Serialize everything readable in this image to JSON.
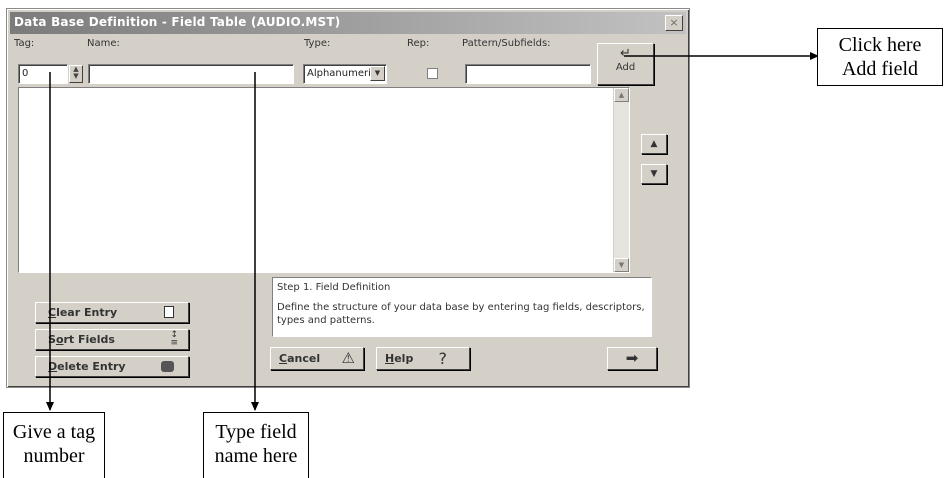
{
  "window": {
    "title": "Data Base Definition - Field Table (AUDIO.MST)",
    "close_glyph": "×"
  },
  "labels": {
    "tag": "Tag:",
    "name": "Name:",
    "type": "Type:",
    "rep": "Rep:",
    "pattern": "Pattern/Subfields:"
  },
  "fields": {
    "tag_value": "0",
    "name_value": "",
    "type_value": "Alphanumeric",
    "rep_checked": false,
    "pattern_value": ""
  },
  "buttons": {
    "add_glyph": "↵",
    "add_label": "Add",
    "move_up_glyph": "▲",
    "move_down_glyph": "▼",
    "clear_entry": {
      "accel": "C",
      "rest": "lear Entry",
      "icon": "document-icon"
    },
    "sort_fields": {
      "pre": "S",
      "accel": "o",
      "rest": "rt Fields",
      "icon": "sort-icon"
    },
    "delete_entry": {
      "accel": "D",
      "rest": "elete Entry",
      "icon": "eraser-icon"
    },
    "cancel": {
      "accel": "C",
      "rest": "ancel",
      "icon": "warning-icon",
      "glyph": "⚠"
    },
    "help": {
      "accel": "H",
      "rest": "elp",
      "icon": "help-icon",
      "glyph": "?"
    },
    "next_glyph": "➡"
  },
  "step": {
    "heading": "Step 1. Field Definition",
    "body": "Define the structure of your data base by entering tag fields, descriptors, types and patterns."
  },
  "annotations": {
    "add_callout": [
      "Click here",
      "Add field"
    ],
    "tag_callout": [
      "Give a tag",
      "number"
    ],
    "name_callout": [
      "Type field",
      "name here"
    ]
  },
  "colors": {
    "dialog_face": "#d4d0c8",
    "titlebar": "#8e8e8e"
  }
}
